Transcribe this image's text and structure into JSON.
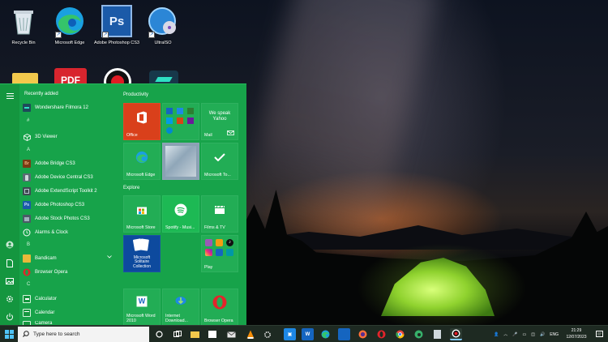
{
  "desktop": {
    "icons": [
      {
        "label": "Recycle Bin",
        "icon": "recycle-bin-icon"
      },
      {
        "label": "Microsoft Edge",
        "icon": "edge-icon"
      },
      {
        "label": "Adobe Photoshop CS3",
        "icon": "photoshop-icon",
        "glyph": "Ps"
      },
      {
        "label": "UltraISO",
        "icon": "ultraiso-icon"
      },
      {
        "label": "",
        "icon": "folder-icon"
      },
      {
        "label": "",
        "icon": "pdf-icon",
        "glyph": "PDF"
      },
      {
        "label": "",
        "icon": "record-icon"
      },
      {
        "label": "",
        "icon": "filmora-icon"
      }
    ]
  },
  "start_menu": {
    "applist": {
      "section_title": "Recently added",
      "items": [
        {
          "label": "Wondershare Filmora 12",
          "icon": "filmora-icon"
        },
        {
          "label": "3D Viewer",
          "icon": "cube-icon"
        },
        {
          "label": "Adobe Bridge CS3",
          "icon": "bridge-icon",
          "glyph": "Br"
        },
        {
          "label": "Adobe Device Central CS3",
          "icon": "device-central-icon"
        },
        {
          "label": "Adobe ExtendScript Toolkit 2",
          "icon": "extendscript-icon"
        },
        {
          "label": "Adobe Photoshop CS3",
          "icon": "photoshop-icon",
          "glyph": "Ps"
        },
        {
          "label": "Adobe Stock Photos CS3",
          "icon": "stock-photos-icon"
        },
        {
          "label": "Alarms & Clock",
          "icon": "alarm-clock-icon"
        },
        {
          "label": "Bandicam",
          "icon": "folder-icon"
        },
        {
          "label": "Browser Opera",
          "icon": "opera-icon"
        },
        {
          "label": "Calculator",
          "icon": "calculator-icon"
        },
        {
          "label": "Calendar",
          "icon": "calendar-icon"
        },
        {
          "label": "Camera",
          "icon": "camera-icon"
        }
      ],
      "letters": {
        "hash": "#",
        "a": "A",
        "b": "B",
        "c": "C"
      }
    },
    "tiles": {
      "productivity_title": "Productivity",
      "explore_title": "Explore",
      "office": "Office",
      "mail": "Mail",
      "mail_promo": "We speak Yahoo",
      "edge": "Microsoft Edge",
      "todo": "Microsoft To...",
      "store": "Microsoft Store",
      "spotify": "Spotify - Musi...",
      "films": "Films & TV",
      "play": "Play",
      "solitaire": "Microsoft Solitaire Collection",
      "word": "Microsoft Word 2010",
      "idm": "Internet Download...",
      "opera": "Browser Opera"
    }
  },
  "taskbar": {
    "search_placeholder": "Type here to search",
    "language": "ENG",
    "time": "21:29",
    "date": "12/07/2023"
  },
  "colors": {
    "start_bg": "#17a34a",
    "tile_bg": "#22ad55",
    "office_red": "#d9401b",
    "spotify_green": "#1db954",
    "taskbar_bg": "#1e2a22"
  }
}
